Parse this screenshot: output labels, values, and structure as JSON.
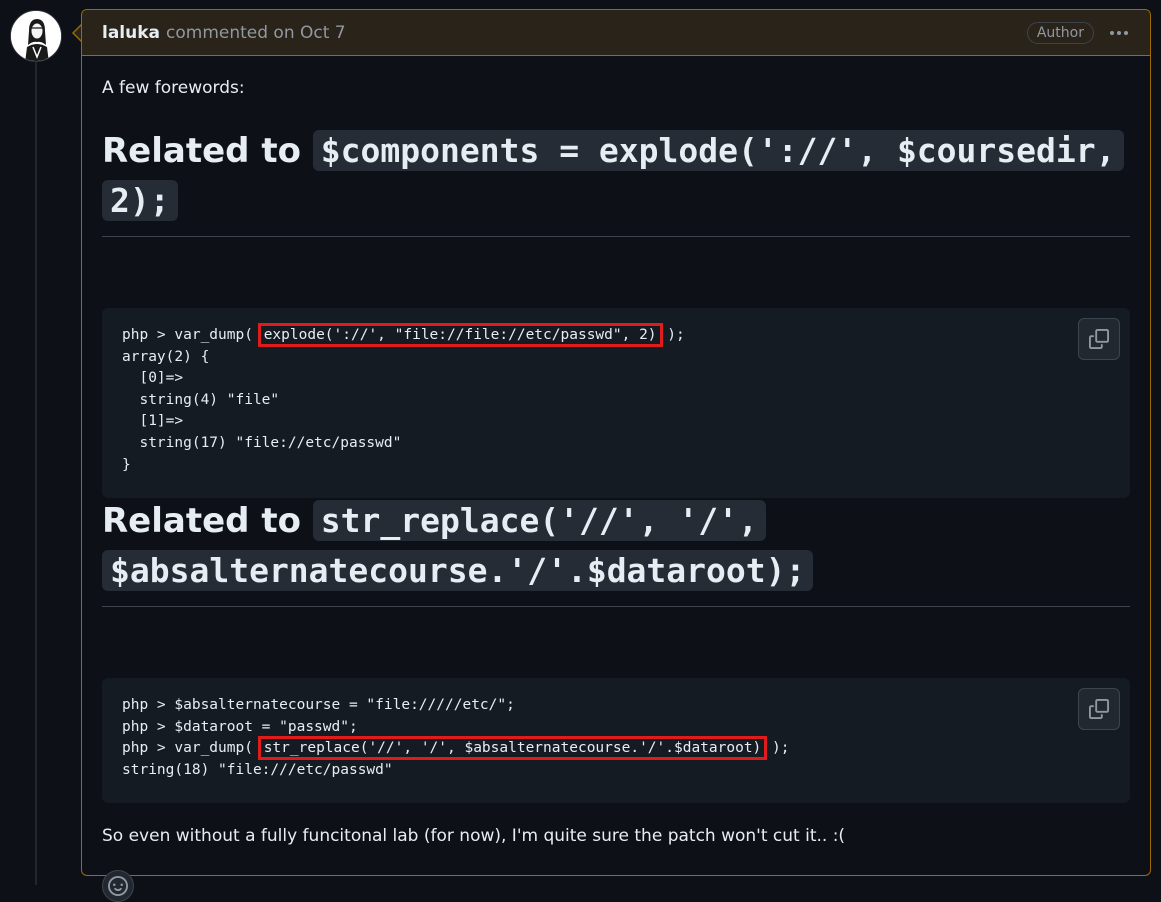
{
  "comment": {
    "author": "laluka",
    "meta": "commented on Oct 7",
    "badge": "Author",
    "menu_icon": "kebab-horizontal-icon"
  },
  "body": {
    "intro": "A few forewords:",
    "section1": {
      "heading_prefix": "Related to ",
      "heading_code": "$components = explode('://', $coursedir, 2);",
      "code_lines": [
        {
          "pre": "php > var_dump( ",
          "hl": "explode('://', \"file://file://etc/passwd\", 2)",
          "post": " );"
        },
        {
          "pre": "array(2) {"
        },
        {
          "pre": "  [0]=>"
        },
        {
          "pre": "  string(4) \"file\""
        },
        {
          "pre": "  [1]=>"
        },
        {
          "pre": "  string(17) \"file://etc/passwd\""
        },
        {
          "pre": "}"
        }
      ]
    },
    "section2": {
      "heading_prefix": "Related to ",
      "heading_code": "str_replace('//', '/', $absalternatecourse.'/'.$dataroot);",
      "code_lines": [
        {
          "pre": "php > $absalternatecourse = \"file://///etc/\";"
        },
        {
          "pre": "php > $dataroot = \"passwd\";"
        },
        {
          "pre": "php > var_dump( ",
          "hl": "str_replace('//', '/', $absalternatecourse.'/'.$dataroot)",
          "post": " );"
        },
        {
          "pre": "string(18) \"file:///etc/passwd\""
        }
      ]
    },
    "conclusion": "So even without a fully funcitonal lab (for now), I'm quite sure the patch won't cut it.. :("
  },
  "colors": {
    "background": "#0d1117",
    "header_bg": "#29231a",
    "border_accent": "#9e6a03",
    "code_bg": "#151b23",
    "highlight_box": "#e01b1b"
  }
}
